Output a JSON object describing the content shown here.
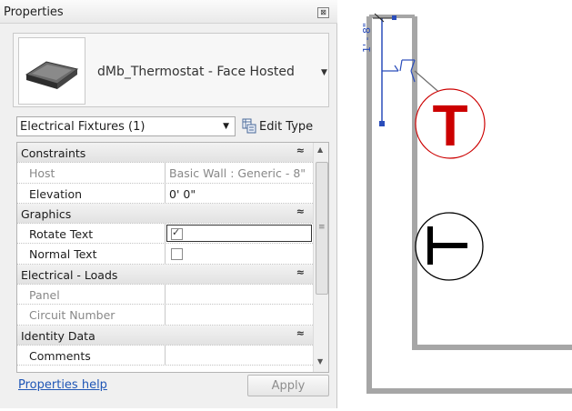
{
  "palette": {
    "title": "Properties",
    "close_glyph": "⊠",
    "type_selector": {
      "name": "dMb_Thermostat - Face Hosted",
      "thumbnail_icon": "thermostat-3d-thumbnail"
    },
    "category_filter": "Electrical Fixtures (1)",
    "edit_type_label": "Edit Type",
    "groups": [
      {
        "label": "Constraints",
        "props": [
          {
            "name": "Host",
            "value": "Basic Wall : Generic - 8\"",
            "disabled": true
          },
          {
            "name": "Elevation",
            "value": "0'  0\""
          }
        ]
      },
      {
        "label": "Graphics",
        "props": [
          {
            "name": "Rotate Text",
            "checked": true
          },
          {
            "name": "Normal Text",
            "checked": false
          }
        ]
      },
      {
        "label": "Electrical - Loads",
        "props": [
          {
            "name": "Panel",
            "value": "",
            "disabled": true
          },
          {
            "name": "Circuit Number",
            "value": "",
            "disabled": true
          }
        ]
      },
      {
        "label": "Identity Data",
        "props": [
          {
            "name": "Comments",
            "value": ""
          }
        ]
      }
    ],
    "collapse_glyph": "≈",
    "help_link": "Properties help",
    "apply_label": "Apply"
  },
  "canvas": {
    "dimension_label": "1' - 8\"",
    "symbols": [
      {
        "name": "thermostat-symbol-selected",
        "letter": "T",
        "color": "#cc0000"
      },
      {
        "name": "thermostat-symbol-rotated",
        "letter": "T",
        "color": "#000000"
      }
    ],
    "colors": {
      "wall": "#a6a6a6",
      "selection": "#2a4dbb",
      "selected_symbol": "#cc0000"
    }
  }
}
